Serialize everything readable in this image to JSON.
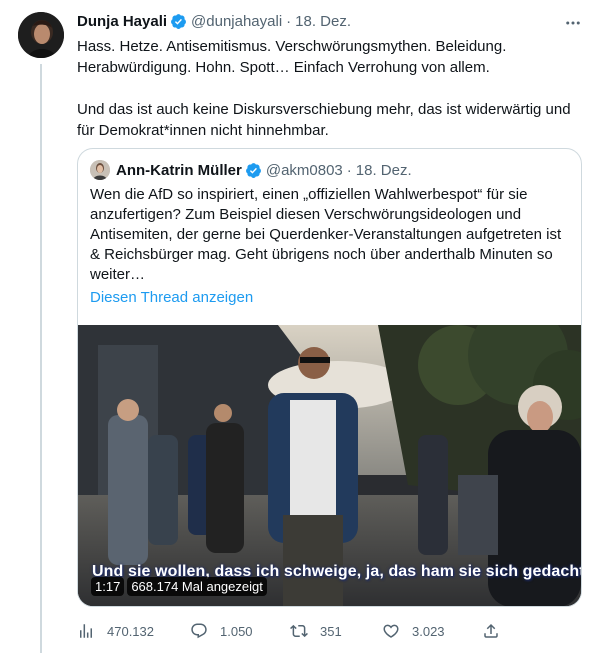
{
  "tweet": {
    "author_name": "Dunja Hayali",
    "handle": "@dunjahayali",
    "separator": "·",
    "date": "18. Dez.",
    "paragraphs": [
      "Hass. Hetze. Antisemitismus. Verschwörungsmythen. Beleidung. Herabwürdigung. Hohn. Spott… Einfach Verrohung von allem.",
      "Und das ist auch keine Diskursverschiebung mehr, das ist widerwärtig und für Demokrat*innen nicht hinnehmbar."
    ]
  },
  "quote": {
    "author_name": "Ann-Katrin Müller",
    "handle": "@akm0803",
    "separator": "·",
    "date": "18. Dez.",
    "text": "Wen die AfD so inspiriert, einen „offiziellen Wahlwerbespot“ für sie anzufertigen? Zum Beispiel diesen Verschwörungsideologen und Antisemiten, der gerne bei Querdenker-Veranstaltungen aufgetreten ist & Reichsbürger mag. Geht übrigens noch über anderthalb Minuten so weiter…",
    "show_thread": "Diesen Thread anzeigen",
    "video": {
      "subtitle": "Und sie wollen, dass ich schweige, ja, das ham sie sich gedacht",
      "duration": "1:17",
      "views": "668.174 Mal angezeigt"
    }
  },
  "actions": {
    "views": "470.132",
    "replies": "1.050",
    "retweets": "351",
    "likes": "3.023"
  },
  "icons": {
    "verified": "verified-badge-icon",
    "more": "more-horizontal-icon",
    "analytics": "analytics-icon",
    "reply": "reply-icon",
    "retweet": "retweet-icon",
    "like": "heart-icon",
    "share": "share-icon"
  },
  "colors": {
    "accent": "#1d9bf0",
    "text": "#0f1419",
    "muted": "#536471",
    "border": "#cfd9de"
  }
}
